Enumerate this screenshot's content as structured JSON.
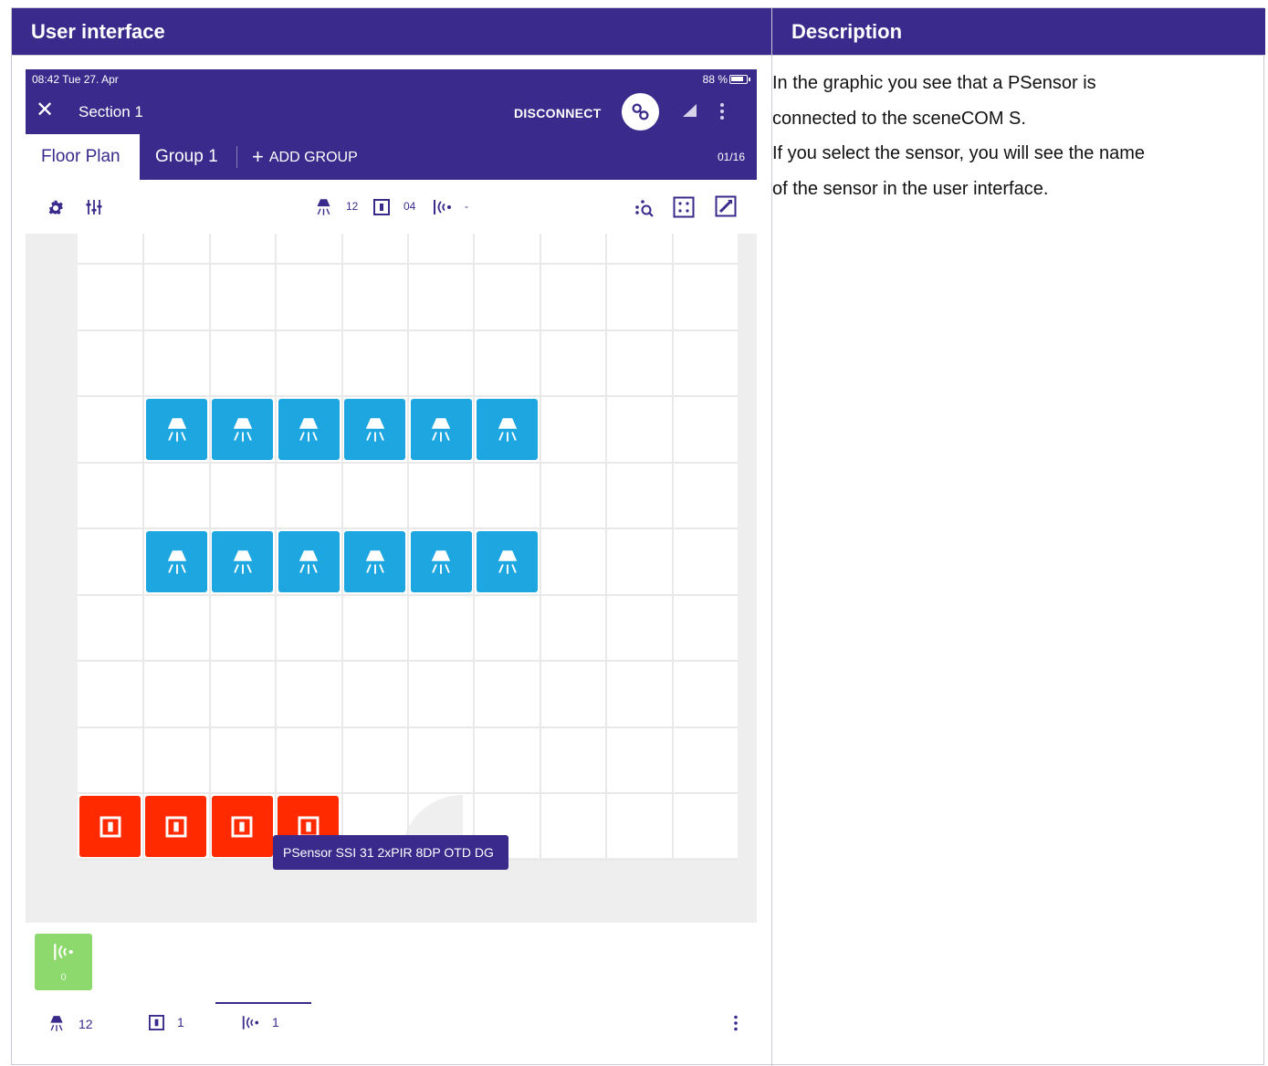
{
  "doc": {
    "left_header": "User interface",
    "right_header": "Description",
    "description": [
      "In the graphic you see that a PSensor is",
      "connected to the sceneCOM S.",
      "If you select the sensor, you will see the name",
      "of the sensor in the user interface."
    ]
  },
  "status_bar": {
    "time": "08:42  Tue 27. Apr",
    "battery": "88 %"
  },
  "app_bar": {
    "title": "Section 1",
    "disconnect_label": "DISCONNECT"
  },
  "tabs": {
    "floor_plan": "Floor Plan",
    "group1": "Group 1",
    "add_group": "ADD GROUP",
    "counter": "01/16"
  },
  "toolbar": {
    "luminaire_count": "12",
    "switch_count": "04",
    "sensor_count": "-"
  },
  "floor": {
    "luminaire_rows": 2,
    "luminaires_per_row": 6,
    "switches": 4,
    "tooltip": "PSensor SSI 31 2xPIR 8DP OTD DG"
  },
  "tray": {
    "sensor_count": "0"
  },
  "bottom_bar": {
    "luminaires": "12",
    "switches": "1",
    "sensors": "1"
  },
  "colors": {
    "primary": "#3a2a8c",
    "luminaire": "#1ea6e0",
    "switch": "#ff2a00",
    "sensor": "#8ed96e"
  }
}
